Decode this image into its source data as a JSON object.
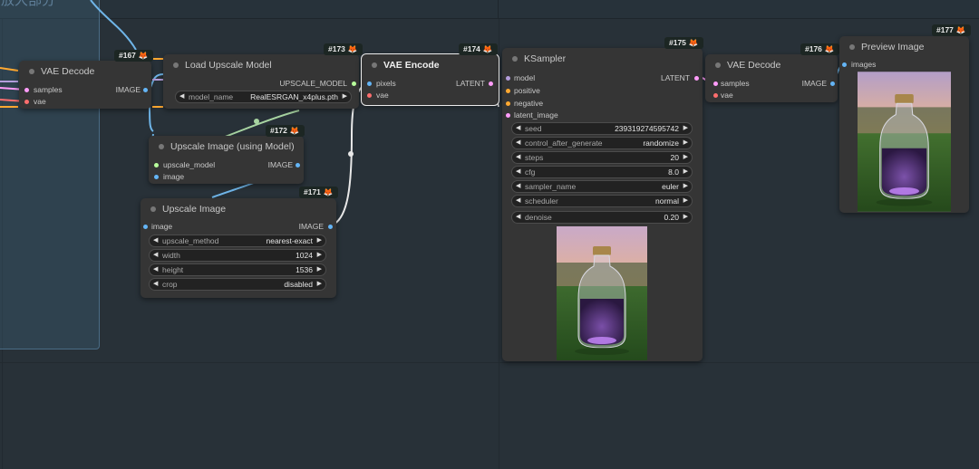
{
  "group": {
    "title": "放大部分"
  },
  "nodes": {
    "vae_decode_167": {
      "badge": "#167",
      "title": "VAE Decode",
      "inputs": [
        "samples",
        "vae"
      ],
      "outputs": [
        "IMAGE"
      ]
    },
    "load_upscale_173": {
      "badge": "#173",
      "title": "Load Upscale Model",
      "outputs": [
        "UPSCALE_MODEL"
      ],
      "widgets": [
        {
          "name": "model_name",
          "value": "RealESRGAN_x4plus.pth"
        }
      ]
    },
    "upscale_model_172": {
      "badge": "#172",
      "title": "Upscale Image (using Model)",
      "inputs": [
        "upscale_model",
        "image"
      ],
      "outputs": [
        "IMAGE"
      ]
    },
    "upscale_image_171": {
      "badge": "#171",
      "title": "Upscale Image",
      "inputs": [
        "image"
      ],
      "outputs": [
        "IMAGE"
      ],
      "widgets": [
        {
          "name": "upscale_method",
          "value": "nearest-exact"
        },
        {
          "name": "width",
          "value": "1024"
        },
        {
          "name": "height",
          "value": "1536"
        },
        {
          "name": "crop",
          "value": "disabled"
        }
      ]
    },
    "vae_encode_174": {
      "badge": "#174",
      "title": "VAE Encode",
      "inputs": [
        "pixels",
        "vae"
      ],
      "outputs": [
        "LATENT"
      ]
    },
    "ksampler_175": {
      "badge": "#175",
      "title": "KSampler",
      "inputs": [
        "model",
        "positive",
        "negative",
        "latent_image"
      ],
      "outputs": [
        "LATENT"
      ],
      "widgets": [
        {
          "name": "seed",
          "value": "239319274595742"
        },
        {
          "name": "control_after_generate",
          "value": "randomize"
        },
        {
          "name": "steps",
          "value": "20"
        },
        {
          "name": "cfg",
          "value": "8.0"
        },
        {
          "name": "sampler_name",
          "value": "euler"
        },
        {
          "name": "scheduler",
          "value": "normal"
        },
        {
          "name": "denoise",
          "value": "0.20"
        }
      ]
    },
    "vae_decode_176": {
      "badge": "#176",
      "title": "VAE Decode",
      "inputs": [
        "samples",
        "vae"
      ],
      "outputs": [
        "IMAGE"
      ]
    },
    "preview_177": {
      "badge": "#177",
      "title": "Preview Image",
      "inputs": [
        "images"
      ]
    }
  },
  "arrows": {
    "left": "◀",
    "right": "▶"
  },
  "badge_icon": "fox-icon",
  "colors": {
    "image": "#64b5f6",
    "vae": "#ff6e6e",
    "latent": "#ff9cf9",
    "upscale_model": "#b8ff9c",
    "model": "#b39ddb",
    "conditioning": "#ffa931"
  }
}
